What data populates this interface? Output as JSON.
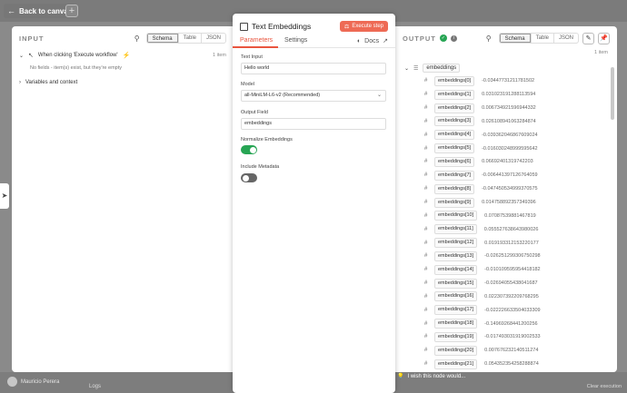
{
  "canvas": {
    "back_label": "Back to canvas",
    "user_name": "Mauricio Perera",
    "logs_label": "Logs",
    "clear_execution": "Clear execution",
    "wish_label": "I wish this node would..."
  },
  "input_panel": {
    "title": "INPUT",
    "view_options": [
      "Schema",
      "Table",
      "JSON"
    ],
    "selected_view": "Schema",
    "trigger_label": "When clicking 'Execute workflow'",
    "items_count": "1 item",
    "no_fields_text": "No fields - item(s) exist, but they're empty",
    "variables_label": "Variables and context"
  },
  "node": {
    "title": "Text Embeddings",
    "execute_label": "Execute step",
    "tabs": [
      "Parameters",
      "Settings"
    ],
    "active_tab": "Parameters",
    "docs_label": "Docs",
    "fields": {
      "text_input_label": "Text Input",
      "text_input_value": "Hello world",
      "model_label": "Model",
      "model_value": "all-MiniLM-L6-v2 (Recommended)",
      "output_field_label": "Output Field",
      "output_field_value": "embeddings",
      "normalize_label": "Normalize Embeddings",
      "normalize_on": true,
      "include_metadata_label": "Include Metadata",
      "include_metadata_on": false
    }
  },
  "output_panel": {
    "title": "OUTPUT",
    "view_options": [
      "Schema",
      "Table",
      "JSON"
    ],
    "selected_view": "Schema",
    "items_count": "1 item",
    "root_label": "embeddings",
    "embeddings": [
      {
        "key": "embeddings[0]",
        "value": "-0.0344773121178150​2"
      },
      {
        "key": "embeddings[1]",
        "value": "0.031023191288113594"
      },
      {
        "key": "embeddings[2]",
        "value": "0.006734921596944332"
      },
      {
        "key": "embeddings[3]",
        "value": "0.02610894106328487​4"
      },
      {
        "key": "embeddings[4]",
        "value": "-0.039362046867609024"
      },
      {
        "key": "embeddings[5]",
        "value": "-0.01603024899959564​2"
      },
      {
        "key": "embeddings[6]",
        "value": "0.0669240131974220​3"
      },
      {
        "key": "embeddings[7]",
        "value": "-0.006441397126764059"
      },
      {
        "key": "embeddings[8]",
        "value": "-0.047450534999370575"
      },
      {
        "key": "embeddings[9]",
        "value": "0.014758892357349396"
      },
      {
        "key": "embeddings[10]",
        "value": "0.07087539881467819"
      },
      {
        "key": "embeddings[11]",
        "value": "0.055527638643980026"
      },
      {
        "key": "embeddings[12]",
        "value": "0.019193312153220177"
      },
      {
        "key": "embeddings[13]",
        "value": "-0.026251299306750298"
      },
      {
        "key": "embeddings[14]",
        "value": "-0.010109595954418182"
      },
      {
        "key": "embeddings[15]",
        "value": "-0.02694055438041687"
      },
      {
        "key": "embeddings[16]",
        "value": "0.022307392209768295"
      },
      {
        "key": "embeddings[17]",
        "value": "-0.022226633504033309"
      },
      {
        "key": "embeddings[18]",
        "value": "-0.14969268441200256"
      },
      {
        "key": "embeddings[19]",
        "value": "-0.017493031919002533"
      },
      {
        "key": "embeddings[20]",
        "value": "0.007676232140511274"
      },
      {
        "key": "embeddings[21]",
        "value": "0.054352354258288874"
      }
    ]
  },
  "colors": {
    "accent": "#e9553f",
    "execute_button": "#ee6a55",
    "toggle_on": "#27a554",
    "success": "#27a554"
  }
}
